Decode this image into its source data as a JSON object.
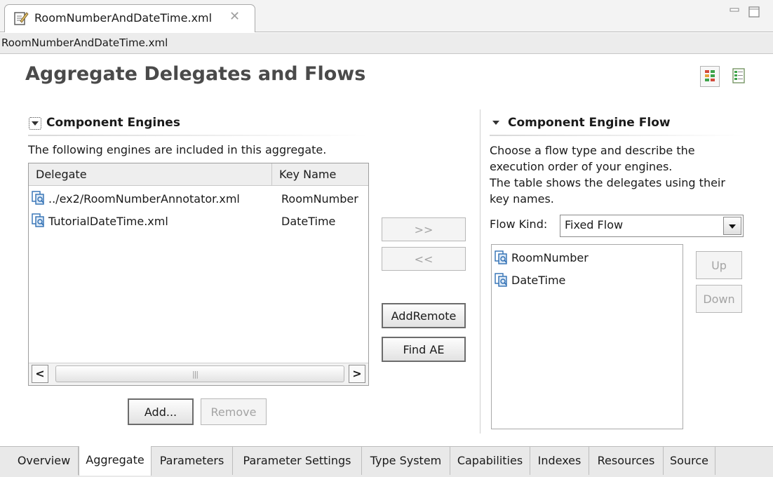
{
  "editor_tab": {
    "title": "RoomNumberAndDateTime.xml",
    "close_glyph": "✕"
  },
  "file_strip": {
    "label": "RoomNumberAndDateTime.xml"
  },
  "page": {
    "title": "Aggregate Delegates and Flows"
  },
  "component_engines": {
    "title": "Component Engines",
    "description": "The following engines are included in this aggregate.",
    "columns": [
      "Delegate",
      "Key Name"
    ],
    "rows": [
      {
        "delegate": "../ex2/RoomNumberAnnotator.xml",
        "key": "RoomNumber",
        "icon": "descriptor-icon"
      },
      {
        "delegate": "TutorialDateTime.xml",
        "key": "DateTime",
        "icon": "descriptor-icon"
      }
    ],
    "scroll": {
      "left": "<",
      "right": ">",
      "grip": "|||"
    },
    "add_label": "Add...",
    "remove_label": "Remove"
  },
  "middle_buttons": {
    "move_right": ">>",
    "move_left": "<<",
    "add_remote": "AddRemote",
    "find_ae": "Find AE"
  },
  "engine_flow": {
    "title": "Component Engine Flow",
    "description": [
      "Choose a flow type and describe the",
      "execution order of your engines.",
      "The table shows the delegates using their",
      "key names."
    ],
    "flow_kind_label": "Flow Kind:",
    "flow_kind_value": "Fixed Flow",
    "items": [
      "RoomNumber",
      "DateTime"
    ],
    "up_label": "Up",
    "down_label": "Down"
  },
  "bottom_tabs": [
    {
      "label": "Overview",
      "active": false
    },
    {
      "label": "Aggregate",
      "active": true
    },
    {
      "label": "Parameters",
      "active": false
    },
    {
      "label": "Parameter Settings",
      "active": false
    },
    {
      "label": "Type System",
      "active": false
    },
    {
      "label": "Capabilities",
      "active": false
    },
    {
      "label": "Indexes",
      "active": false
    },
    {
      "label": "Resources",
      "active": false
    },
    {
      "label": "Source",
      "active": false
    }
  ],
  "colors": {
    "title": "#4a4a4a",
    "icon_blue": "#2f6fb3",
    "disabled": "#a4a4a4"
  }
}
